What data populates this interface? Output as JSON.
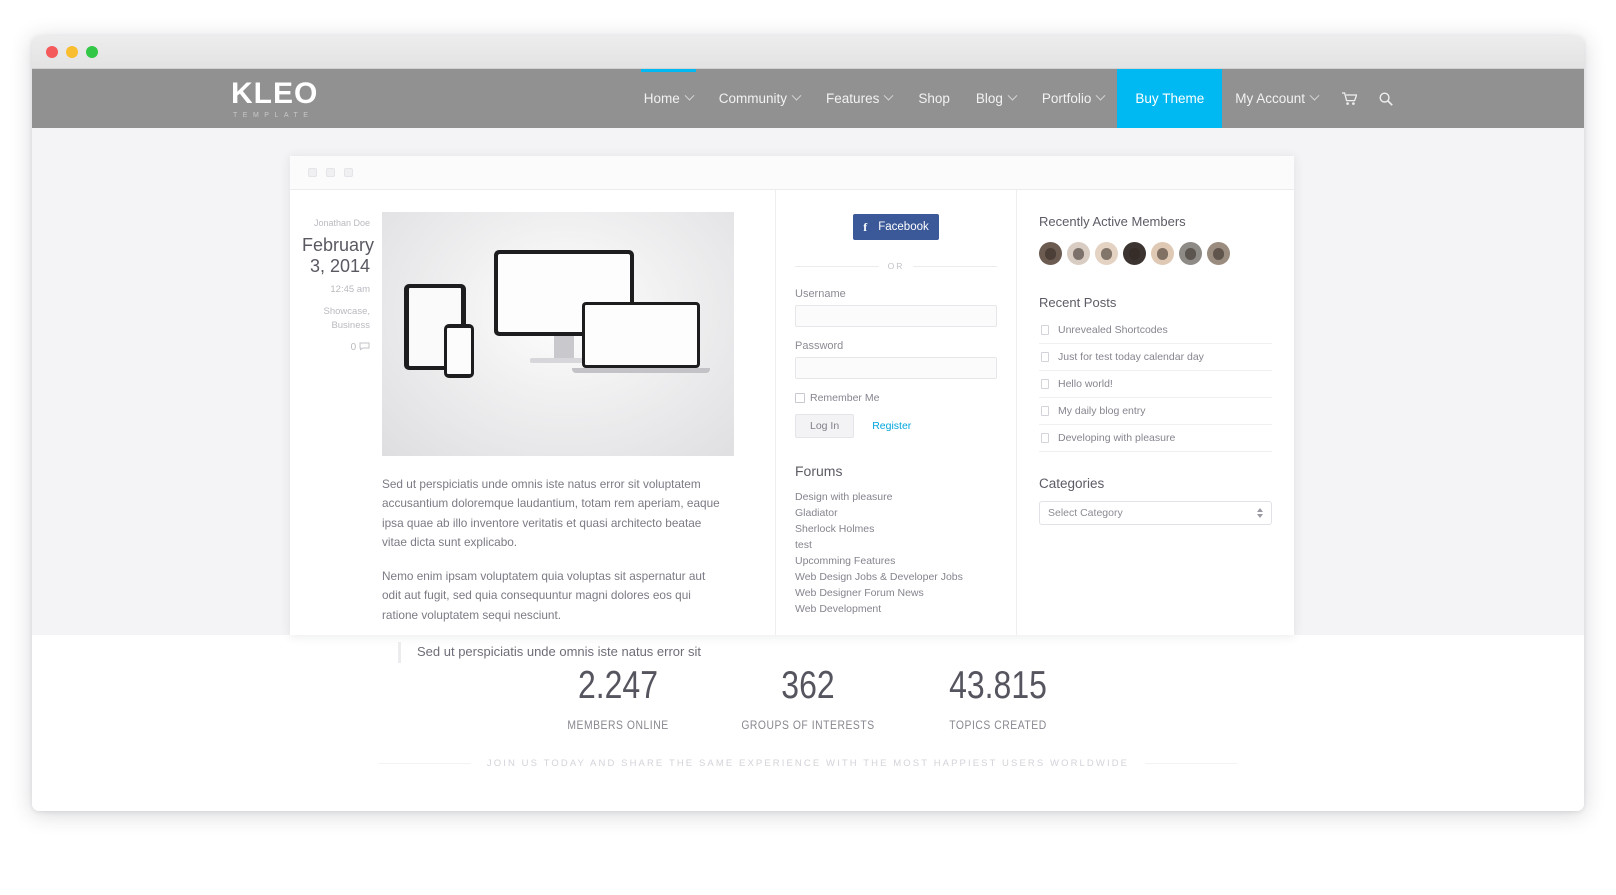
{
  "brand": {
    "logo_main": "KLEO",
    "logo_sub": "TEMPLATE",
    "accent_color": "#00b9f2",
    "header_bg": "#919191"
  },
  "nav": {
    "items": [
      {
        "label": "Home",
        "has_dropdown": true,
        "active": true,
        "highlight": false
      },
      {
        "label": "Community",
        "has_dropdown": true,
        "active": false,
        "highlight": false
      },
      {
        "label": "Features",
        "has_dropdown": true,
        "active": false,
        "highlight": false
      },
      {
        "label": "Shop",
        "has_dropdown": false,
        "active": false,
        "highlight": false
      },
      {
        "label": "Blog",
        "has_dropdown": true,
        "active": false,
        "highlight": false
      },
      {
        "label": "Portfolio",
        "has_dropdown": true,
        "active": false,
        "highlight": false
      },
      {
        "label": "Buy Theme",
        "has_dropdown": false,
        "active": false,
        "highlight": true
      },
      {
        "label": "My Account",
        "has_dropdown": true,
        "active": false,
        "highlight": false
      }
    ],
    "cart_icon": "shopping-cart-icon",
    "search_icon": "search-icon"
  },
  "post": {
    "author": "Jonathan Doe",
    "date": "February 3, 2014",
    "time": "12:45 am",
    "categories": "Showcase, Business",
    "comment_count": "0",
    "paragraph1": "Sed ut perspiciatis unde omnis iste natus error sit voluptatem accusantium doloremque laudantium, totam rem aperiam, eaque ipsa quae ab illo inventore veritatis et quasi architecto beatae vitae dicta sunt explicabo.",
    "paragraph2": "Nemo enim ipsam voluptatem quia voluptas sit aspernatur aut odit aut fugit, sed quia consequuntur magni dolores eos qui ratione voluptatem sequi nesciunt.",
    "quote": "Sed ut perspiciatis unde omnis iste natus error sit"
  },
  "login": {
    "facebook_label": "Facebook",
    "or_label": "OR",
    "username_label": "Username",
    "username_value": "",
    "password_label": "Password",
    "password_value": "",
    "remember_label": "Remember Me",
    "login_button": "Log In",
    "register_link": "Register",
    "facebook_color": "#3b5998"
  },
  "forums": {
    "title": "Forums",
    "items": [
      "Design with pleasure",
      "Gladiator",
      "Sherlock Holmes",
      "test",
      "Upcomming Features",
      "Web Design Jobs & Developer Jobs",
      "Web Designer Forum News",
      "Web Development"
    ]
  },
  "sidebar": {
    "members_title": "Recently Active Members",
    "member_count": 7,
    "recent_posts_title": "Recent Posts",
    "recent_posts": [
      "Unrevealed Shortcodes",
      "Just for test today calendar day",
      "Hello world!",
      "My daily blog entry",
      "Developing with pleasure"
    ],
    "categories_title": "Categories",
    "category_selected": "Select Category"
  },
  "stats": {
    "items": [
      {
        "number": "2.247",
        "label": "MEMBERS ONLINE"
      },
      {
        "number": "362",
        "label": "GROUPS OF INTERESTS"
      },
      {
        "number": "43.815",
        "label": "TOPICS CREATED"
      }
    ],
    "tagline": "JOIN US TODAY AND SHARE THE SAME EXPERIENCE WITH THE MOST HAPPIEST USERS WORLDWIDE"
  }
}
